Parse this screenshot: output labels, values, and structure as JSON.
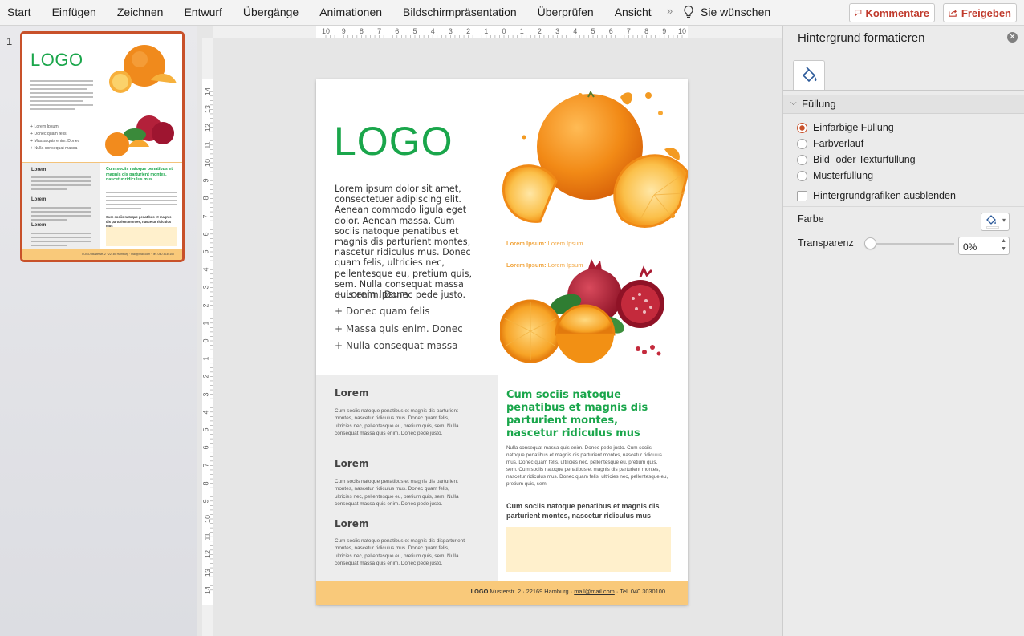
{
  "ribbon": {
    "tabs": [
      "Start",
      "Einfügen",
      "Zeichnen",
      "Entwurf",
      "Übergänge",
      "Animationen",
      "Bildschirmpräsentation",
      "Überprüfen",
      "Ansicht"
    ],
    "more": "»",
    "tell_me": "Sie wünschen",
    "comments_label": "Kommentare",
    "share_label": "Freigeben",
    "accent_color": "#c0392b"
  },
  "thumbnails": {
    "slide_number": "1",
    "logo": "LOGO",
    "bullets": [
      "+ Lorem Ipsum",
      "+ Donec quam felis",
      "+ Massa quis enim. Donec",
      "+ Nulla consequat massa"
    ],
    "left_heads": [
      "Lorem",
      "Lorem",
      "Lorem"
    ],
    "right_head": "Cum sociis natoque penatibus et magnis dis parturient montes, nascetur ridiculus mus",
    "right_bold": "Cum sociis natoque penatibus et magnis dis parturient montes, nascetur ridiculus mus",
    "footer": "LOGO Musterstr. 2 · 22169 Hamburg · mail@mail.com · Tel. 040 3030100",
    "selected_border": "#c8512a"
  },
  "rulers": {
    "horizontal": [
      "10",
      "9",
      "8",
      "7",
      "6",
      "5",
      "4",
      "3",
      "2",
      "1",
      "0",
      "1",
      "2",
      "3",
      "4",
      "5",
      "6",
      "7",
      "8",
      "9",
      "10"
    ],
    "vertical": [
      "14",
      "13",
      "12",
      "11",
      "10",
      "9",
      "8",
      "7",
      "6",
      "5",
      "4",
      "3",
      "2",
      "1",
      "0",
      "1",
      "2",
      "3",
      "4",
      "5",
      "6",
      "7",
      "8",
      "9",
      "10",
      "11",
      "12",
      "13",
      "14"
    ]
  },
  "slide": {
    "logo": "LOGO",
    "logo_color": "#1aa64b",
    "intro": "Lorem ipsum dolor sit amet, consectetuer adipiscing elit. Aenean commodo ligula eget dolor. Aenean massa. Cum sociis natoque penatibus et magnis dis parturient montes, nascetur ridiculus mus. Donec quam felis, ultricies nec, pellentesque eu, pretium quis, sem. Nulla consequat massa quis enim. Donec pede justo.",
    "bullets": [
      "+ Lorem Ipsum",
      "+ Donec quam felis",
      "+ Massa quis enim. Donec",
      "+ Nulla consequat massa"
    ],
    "caption1_bold": "Lorem Ipsum:",
    "caption1_rest": " Lorem Ipsum",
    "caption2_bold": "Lorem Ipsum:",
    "caption2_rest": " Lorem Ipsum",
    "left_blocks": [
      {
        "heading": "Lorem",
        "text": "Cum sociis natoque penatibus et magnis dis parturient montes, nascetur ridiculus mus. Donec quam felis, ultricies nec, pellentesque eu, pretium quis, sem. Nulla consequat massa quis enim. Donec pede justo."
      },
      {
        "heading": "Lorem",
        "text": "Cum sociis natoque penatibus et magnis dis parturient montes, nascetur ridiculus mus. Donec quam felis, ultricies nec, pellentesque eu, pretium quis, sem. Nulla consequat massa quis enim. Donec pede justo."
      },
      {
        "heading": "Lorem",
        "text": "Cum sociis natoque penatibus et magnis dis disparturient montes, nascetur ridiculus mus. Donec quam felis, ultricies nec, pellentesque eu, pretium quis, sem. Nulla consequat massa quis enim. Donec pede justo."
      }
    ],
    "right_heading": "Cum sociis natoque penatibus et magnis dis parturient montes, nascetur ridiculus mus",
    "right_text": "Nulla consequat massa quis enim. Donec pede justo. Cum sociis natoque penatibus et magnis dis parturient montes, nascetur ridiculus mus. Donec quam felis, ultricies nec, pellentesque eu, pretium quis, sem. Cum sociis natoque penatibus et magnis dis parturient montes, nascetur ridiculus mus. Donec quam felis, ultricies nec, pellentesque eu, pretium quis, sem.",
    "right_bold": "Cum sociis natoque penatibus et magnis dis parturient montes, nascetur ridiculus mus",
    "footer_logo": "LOGO",
    "footer_address": " Musterstr. 2 · 22169 Hamburg · ",
    "footer_mail": "mail@mail.com",
    "footer_tel": " · Tel. 040 3030100",
    "footer_color": "#f9c97a",
    "cream_color": "#fff0cc"
  },
  "format_pane": {
    "title": "Hintergrund formatieren",
    "section": "Füllung",
    "fill_options": [
      "Einfarbige Füllung",
      "Farbverlauf",
      "Bild- oder Texturfüllung",
      "Musterfüllung"
    ],
    "selected_fill": "Einfarbige Füllung",
    "hide_graphics_label": "Hintergrundgrafiken ausblenden",
    "hide_graphics_checked": false,
    "color_label": "Farbe",
    "transparency_label": "Transparenz",
    "transparency_value": "0%",
    "transparency_level": 0
  }
}
